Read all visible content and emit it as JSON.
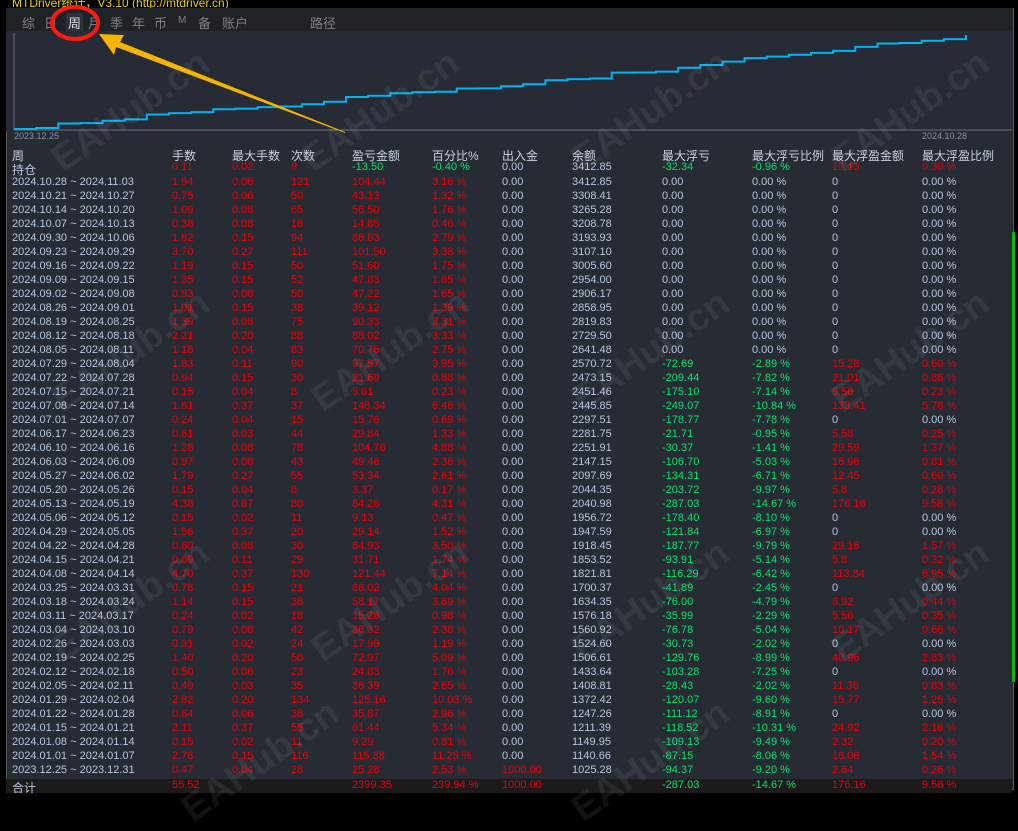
{
  "app": {
    "title": "MTDriver统计，V3.10 (http://mtdriver.cn)"
  },
  "tabs": [
    {
      "label": "综",
      "active": false
    },
    {
      "label": "日",
      "active": false
    },
    {
      "label": "周",
      "active": true
    },
    {
      "label": "月",
      "active": false
    },
    {
      "label": "季",
      "active": false
    },
    {
      "label": "年",
      "active": false
    },
    {
      "label": "币",
      "active": false
    },
    {
      "label": "M",
      "active": false
    },
    {
      "label": "备",
      "active": false
    },
    {
      "label": "账户",
      "active": false
    },
    {
      "label": "路径",
      "active": false
    }
  ],
  "chart": {
    "start_date": "2023.12.25",
    "end_date": "2024.10.28",
    "line_color": "#00b4f0"
  },
  "watermark": "EAHub.cn",
  "colors": {
    "profit": "#e8000b",
    "loss": "#00e46a",
    "neutral": "#b9c6de",
    "accent": "#e8d000"
  },
  "table": {
    "headers": [
      "周",
      "手数",
      "最大手数",
      "次数",
      "盈亏金额",
      "百分比%",
      "出入金",
      "余额",
      "最大浮亏",
      "最大浮亏比例",
      "最大浮盈金额",
      "最大浮盈比例"
    ],
    "open_positions": [
      "持仓",
      "0.11",
      "0.02",
      "9",
      "-13.50",
      "-0.40 %",
      "0.00",
      "3412.85",
      "-32.34",
      "-0.96 %",
      "10.13",
      "0.30 %"
    ],
    "rows": [
      [
        "2024.10.28 ~ 2024.11.03",
        "1.94",
        "0.06",
        "121",
        "104.44",
        "3.16 %",
        "0.00",
        "3412.85",
        "0.00",
        "0.00 %",
        "0",
        "0.00 %"
      ],
      [
        "2024.10.21 ~ 2024.10.27",
        "0.75",
        "0.06",
        "50",
        "43.13",
        "1.32 %",
        "0.00",
        "3308.41",
        "0.00",
        "0.00 %",
        "0",
        "0.00 %"
      ],
      [
        "2024.10.14 ~ 2024.10.20",
        "1.09",
        "0.08",
        "65",
        "56.50",
        "1.76 %",
        "0.00",
        "3265.28",
        "0.00",
        "0.00 %",
        "0",
        "0.00 %"
      ],
      [
        "2024.10.07 ~ 2024.10.13",
        "0.38",
        "0.08",
        "16",
        "14.85",
        "0.46 %",
        "0.00",
        "3208.78",
        "0.00",
        "0.00 %",
        "0",
        "0.00 %"
      ],
      [
        "2024.09.30 ~ 2024.10.06",
        "1.82",
        "0.15",
        "94",
        "86.83",
        "2.79 %",
        "0.00",
        "3193.93",
        "0.00",
        "0.00 %",
        "0",
        "0.00 %"
      ],
      [
        "2024.09.23 ~ 2024.09.29",
        "3.70",
        "0.27",
        "111",
        "101.50",
        "3.38 %",
        "0.00",
        "3107.10",
        "0.00",
        "0.00 %",
        "0",
        "0.00 %"
      ],
      [
        "2024.09.16 ~ 2024.09.22",
        "1.19",
        "0.15",
        "50",
        "51.60",
        "1.75 %",
        "0.00",
        "3005.60",
        "0.00",
        "0.00 %",
        "0",
        "0.00 %"
      ],
      [
        "2024.09.09 ~ 2024.09.15",
        "1.35",
        "0.15",
        "52",
        "47.83",
        "1.65 %",
        "0.00",
        "2954.00",
        "0.00",
        "0.00 %",
        "0",
        "0.00 %"
      ],
      [
        "2024.09.02 ~ 2024.09.08",
        "0.93",
        "0.08",
        "50",
        "47.22",
        "1.65 %",
        "0.00",
        "2906.17",
        "0.00",
        "0.00 %",
        "0",
        "0.00 %"
      ],
      [
        "2024.08.26 ~ 2024.09.01",
        "1.01",
        "0.15",
        "38",
        "39.12",
        "1.39 %",
        "0.00",
        "2858.95",
        "0.00",
        "0.00 %",
        "0",
        "0.00 %"
      ],
      [
        "2024.08.19 ~ 2024.08.25",
        "1.39",
        "0.08",
        "75",
        "90.33",
        "3.31 %",
        "0.00",
        "2819.83",
        "0.00",
        "0.00 %",
        "0",
        "0.00 %"
      ],
      [
        "2024.08.12 ~ 2024.08.18",
        "2.21",
        "0.20",
        "88",
        "88.02",
        "3.33 %",
        "0.00",
        "2729.50",
        "0.00",
        "0.00 %",
        "0",
        "0.00 %"
      ],
      [
        "2024.08.05 ~ 2024.08.11",
        "1.18",
        "0.04",
        "83",
        "70.76",
        "2.75 %",
        "0.00",
        "2641.48",
        "0.00",
        "0.00 %",
        "0",
        "0.00 %"
      ],
      [
        "2024.07.29 ~ 2024.08.04",
        "1.83",
        "0.11",
        "90",
        "97.57",
        "3.95 %",
        "0.00",
        "2570.72",
        "-72.69",
        "-2.89 %",
        "15.28",
        "0.60 %"
      ],
      [
        "2024.07.22 ~ 2024.07.28",
        "0.94",
        "0.15",
        "30",
        "21.69",
        "0.88 %",
        "0.00",
        "2473.15",
        "-209.44",
        "-7.82 %",
        "21.01",
        "0.86 %"
      ],
      [
        "2024.07.15 ~ 2024.07.21",
        "0.15",
        "0.04",
        "8",
        "5.61",
        "0.23 %",
        "0.00",
        "2451.46",
        "-175.10",
        "-7.14 %",
        "5.56",
        "0.23 %"
      ],
      [
        "2024.07.08 ~ 2024.07.14",
        "1.81",
        "0.37",
        "37",
        "148.34",
        "6.46 %",
        "0.00",
        "2445.85",
        "-249.07",
        "-10.84 %",
        "133.41",
        "5.78 %"
      ],
      [
        "2024.07.01 ~ 2024.07.07",
        "0.24",
        "0.04",
        "15",
        "15.76",
        "0.69 %",
        "0.00",
        "2297.51",
        "-178.77",
        "-7.78 %",
        "0",
        "0.00 %"
      ],
      [
        "2024.06.17 ~ 2024.06.23",
        "0.61",
        "0.03",
        "44",
        "29.84",
        "1.33 %",
        "0.00",
        "2281.75",
        "-21.71",
        "-0.95 %",
        "5.58",
        "0.25 %"
      ],
      [
        "2024.06.10 ~ 2024.06.16",
        "1.28",
        "0.08",
        "78",
        "104.76",
        "4.88 %",
        "0.00",
        "2251.91",
        "-30.37",
        "-1.41 %",
        "29.59",
        "1.37 %"
      ],
      [
        "2024.06.03 ~ 2024.06.09",
        "0.97",
        "0.08",
        "43",
        "49.46",
        "2.36 %",
        "0.00",
        "2147.15",
        "-106.70",
        "-5.03 %",
        "16.96",
        "0.81 %"
      ],
      [
        "2024.05.27 ~ 2024.06.02",
        "1.79",
        "0.27",
        "55",
        "53.34",
        "2.61 %",
        "0.00",
        "2097.69",
        "-134.31",
        "-6.71 %",
        "12.45",
        "0.60 %"
      ],
      [
        "2024.05.20 ~ 2024.05.26",
        "0.15",
        "0.04",
        "8",
        "3.37",
        "0.17 %",
        "0.00",
        "2044.35",
        "-203.72",
        "-9.97 %",
        "5.8",
        "0.28 %"
      ],
      [
        "2024.05.13 ~ 2024.05.19",
        "4.38",
        "0.67",
        "80",
        "84.26",
        "4.31 %",
        "0.00",
        "2040.98",
        "-287.03",
        "-14.67 %",
        "176.16",
        "9.58 %"
      ],
      [
        "2024.05.06 ~ 2024.05.12",
        "0.15",
        "0.02",
        "11",
        "9.13",
        "0.47 %",
        "0.00",
        "1956.72",
        "-178.40",
        "-8.10 %",
        "0",
        "0.00 %"
      ],
      [
        "2024.04.29 ~ 2024.05.05",
        "1.56",
        "0.37",
        "20",
        "29.14",
        "1.52 %",
        "0.00",
        "1947.59",
        "-121.84",
        "-6.97 %",
        "0",
        "0.00 %"
      ],
      [
        "2024.04.22 ~ 2024.04.28",
        "0.60",
        "0.08",
        "30",
        "64.93",
        "3.50 %",
        "0.00",
        "1918.45",
        "-187.77",
        "-9.79 %",
        "29.16",
        "1.57 %"
      ],
      [
        "2024.04.15 ~ 2024.04.21",
        "0.69",
        "0.11",
        "29",
        "31.71",
        "1.74 %",
        "0.00",
        "1853.52",
        "-93.91",
        "-5.14 %",
        "5.8",
        "0.32 %"
      ],
      [
        "2024.04.08 ~ 2024.04.14",
        "4.70",
        "0.37",
        "130",
        "121.44",
        "7.14 %",
        "0.00",
        "1821.81",
        "-116.29",
        "-6.42 %",
        "113.84",
        "6.95 %"
      ],
      [
        "2024.03.25 ~ 2024.03.31",
        "0.78",
        "0.15",
        "21",
        "66.02",
        "4.04 %",
        "0.00",
        "1700.37",
        "-41.89",
        "-2.45 %",
        "0",
        "0.00 %"
      ],
      [
        "2024.03.18 ~ 2024.03.24",
        "1.14",
        "0.15",
        "38",
        "58.17",
        "3.69 %",
        "0.00",
        "1634.35",
        "-76.00",
        "-4.79 %",
        "6.92",
        "0.44 %"
      ],
      [
        "2024.03.11 ~ 2024.03.17",
        "0.24",
        "0.02",
        "18",
        "15.26",
        "0.98 %",
        "0.00",
        "1576.18",
        "-35.99",
        "-2.29 %",
        "5.56",
        "0.35 %"
      ],
      [
        "2024.03.04 ~ 2024.03.10",
        "0.79",
        "0.08",
        "42",
        "36.32",
        "2.38 %",
        "0.00",
        "1560.92",
        "-76.78",
        "-5.04 %",
        "10.17",
        "0.66 %"
      ],
      [
        "2024.02.26 ~ 2024.03.03",
        "0.31",
        "0.02",
        "24",
        "17.99",
        "1.19 %",
        "0.00",
        "1524.60",
        "-30.73",
        "-2.02 %",
        "0",
        "0.00 %"
      ],
      [
        "2024.02.19 ~ 2024.02.25",
        "1.40",
        "0.20",
        "50",
        "72.97",
        "5.09 %",
        "0.00",
        "1506.61",
        "-129.76",
        "-8.99 %",
        "40.96",
        "2.83 %"
      ],
      [
        "2024.02.12 ~ 2024.02.18",
        "0.50",
        "0.06",
        "23",
        "24.83",
        "1.76 %",
        "0.00",
        "1433.64",
        "-103.28",
        "-7.25 %",
        "0",
        "0.00 %"
      ],
      [
        "2024.02.05 ~ 2024.02.11",
        "0.49",
        "0.03",
        "35",
        "36.39",
        "2.65 %",
        "0.00",
        "1408.81",
        "-28.43",
        "-2.02 %",
        "11.36",
        "0.83 %"
      ],
      [
        "2024.01.29 ~ 2024.02.04",
        "2.82",
        "0.20",
        "134",
        "125.16",
        "10.03 %",
        "0.00",
        "1372.42",
        "-120.07",
        "-9.60 %",
        "15.77",
        "1.25 %"
      ],
      [
        "2024.01.22 ~ 2024.01.28",
        "0.64",
        "0.06",
        "38",
        "35.87",
        "2.96 %",
        "0.00",
        "1247.26",
        "-111.12",
        "-8.91 %",
        "0",
        "0.00 %"
      ],
      [
        "2024.01.15 ~ 2024.01.21",
        "2.11",
        "0.37",
        "55",
        "61.44",
        "5.34 %",
        "0.00",
        "1211.39",
        "-118.52",
        "-10.31 %",
        "24.92",
        "2.16 %"
      ],
      [
        "2024.01.08 ~ 2024.01.14",
        "0.15",
        "0.02",
        "11",
        "9.29",
        "0.81 %",
        "0.00",
        "1149.95",
        "-109.13",
        "-9.49 %",
        "2.32",
        "0.20 %"
      ],
      [
        "2024.01.01 ~ 2024.01.07",
        "2.78",
        "0.15",
        "116",
        "115.38",
        "11.25 %",
        "0.00",
        "1140.66",
        "-87.15",
        "-8.06 %",
        "16.08",
        "1.54 %"
      ],
      [
        "2023.12.25 ~ 2023.12.31",
        "0.47",
        "0.04",
        "28",
        "25.28",
        "2.53 %",
        "1000.00",
        "1025.28",
        "-94.37",
        "-9.20 %",
        "2.64",
        "0.26 %"
      ]
    ],
    "total": [
      "合计",
      "55.52",
      "",
      "",
      "2399.35",
      "239.94 %",
      "1000.00",
      "",
      "-287.03",
      "-14.67 %",
      "176.16",
      "9.58 %"
    ]
  }
}
